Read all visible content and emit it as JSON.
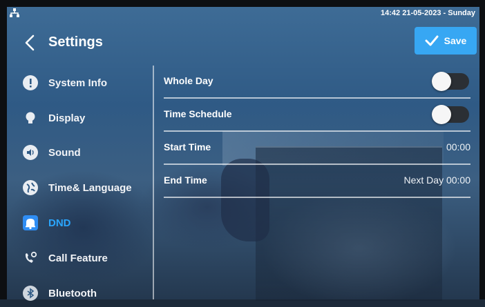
{
  "status_bar": {
    "datetime": "14:42 21-05-2023 - Sunday",
    "network_icon": "network-icon"
  },
  "header": {
    "back_icon": "chevron-left-icon",
    "title": "Settings",
    "save_label": "Save",
    "save_icon": "check-icon",
    "accent_color": "#37a7f3"
  },
  "sidebar": {
    "items": [
      {
        "label": "System Info",
        "icon": "info-icon"
      },
      {
        "label": "Display",
        "icon": "bulb-icon"
      },
      {
        "label": "Sound",
        "icon": "speaker-icon"
      },
      {
        "label": "Time& Language",
        "icon": "globe-icon"
      },
      {
        "label": "DND",
        "icon": "bell-icon",
        "active": true
      },
      {
        "label": "Call Feature",
        "icon": "phone-settings-icon"
      },
      {
        "label": "Bluetooth",
        "icon": "bluetooth-icon"
      }
    ],
    "active_color": "#2aa6ff"
  },
  "dnd": {
    "rows": [
      {
        "label": "Whole Day",
        "type": "toggle",
        "on": false
      },
      {
        "label": "Time Schedule",
        "type": "toggle",
        "on": false
      },
      {
        "label": "Start Time",
        "type": "value",
        "value": "00:00"
      },
      {
        "label": "End Time",
        "type": "value",
        "value": "Next Day 00:00"
      }
    ]
  }
}
